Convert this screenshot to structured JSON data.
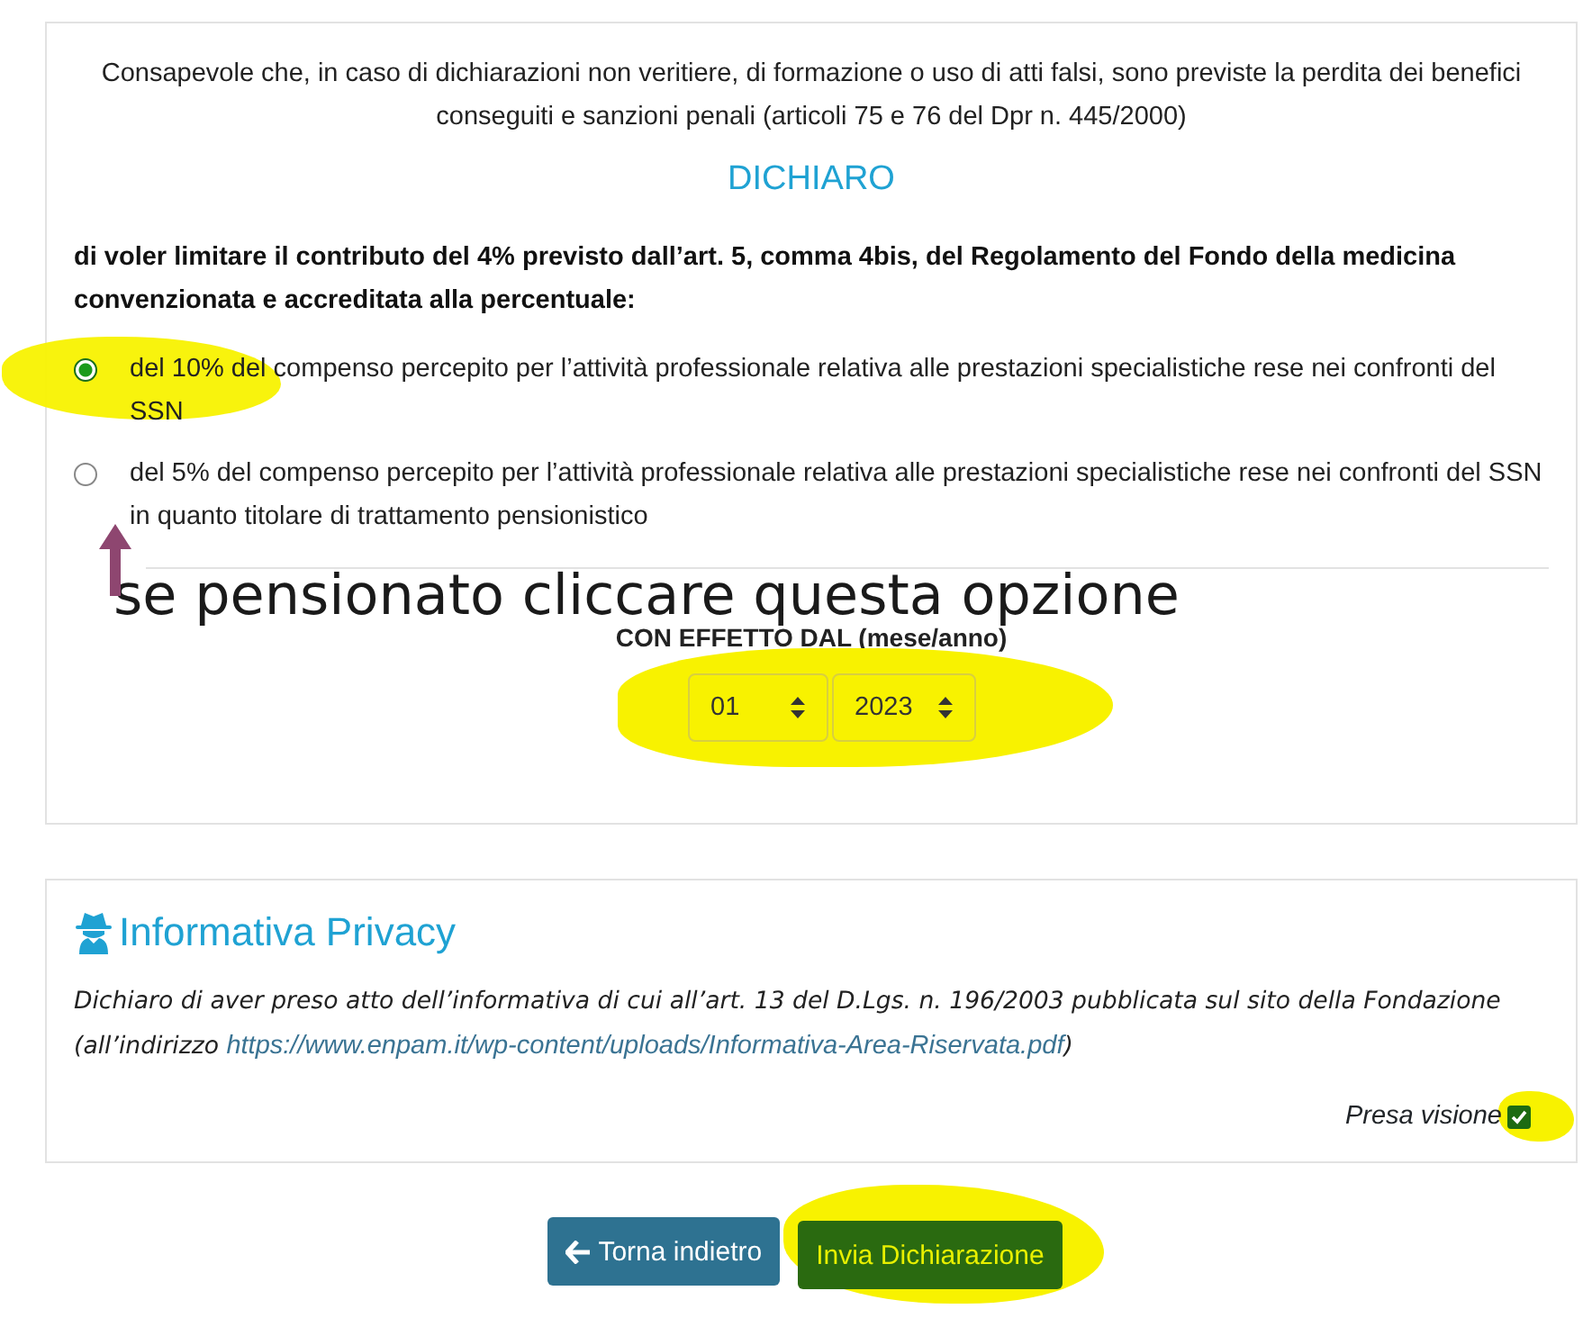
{
  "declaration_card": {
    "intro": "Consapevole che, in caso di dichiarazioni non veritiere, di formazione o uso di atti falsi, sono previste la perdita dei benefici conseguiti e sanzioni penali (articoli 75 e 76 del Dpr n. 445/2000)",
    "heading": "DICHIARO",
    "statement": "di voler limitare il contributo del 4% previsto dall’art. 5, comma 4bis, del Regolamento del Fondo della medicina convenzionata e accreditata alla percentuale:",
    "options": [
      {
        "label": "del 10% del compenso percepito per l’attività professionale relativa alle prestazioni specialistiche rese nei confronti del SSN",
        "selected": true
      },
      {
        "label": "del 5% del compenso percepito per l’attività professionale relativa alle prestazioni specialistiche rese nei confronti del SSN in quanto titolare di trattamento pensionistico",
        "selected": false
      }
    ],
    "annotation": "se pensionato cliccare questa opzione",
    "effective_label": "CON EFFETTO DAL (mese/anno)",
    "month": "01",
    "year": "2023"
  },
  "privacy_card": {
    "title": "Informativa Privacy",
    "text_before": "Dichiaro di aver preso atto dell’informativa di cui all’art. 13 del D.Lgs. n. 196/2003 pubblicata sul sito della Fondazione (all’indirizzo ",
    "link": "https://www.enpam.it/wp-content/uploads/Informativa-Area-Riservata.pdf",
    "text_after": ")",
    "consent": {
      "label": "Presa visione",
      "checked": true
    }
  },
  "buttons": {
    "back": "Torna indietro",
    "submit": "Invia Dichiarazione"
  }
}
